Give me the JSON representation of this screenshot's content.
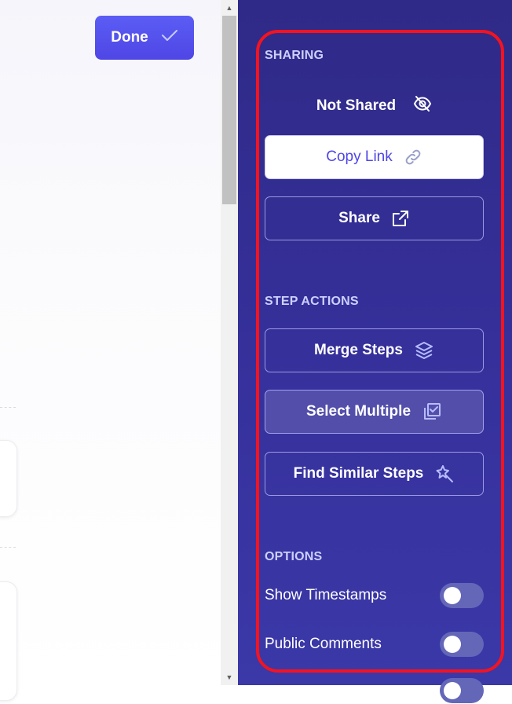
{
  "header": {
    "done_label": "Done"
  },
  "sharing": {
    "title": "SHARING",
    "status": "Not Shared",
    "copy_link_label": "Copy Link",
    "share_label": "Share"
  },
  "step_actions": {
    "title": "STEP ACTIONS",
    "merge_label": "Merge Steps",
    "select_multiple_label": "Select Multiple",
    "find_similar_label": "Find Similar Steps"
  },
  "options": {
    "title": "OPTIONS",
    "items": [
      {
        "label": "Show Timestamps",
        "enabled": false
      },
      {
        "label": "Public Comments",
        "enabled": false
      },
      {
        "label": "",
        "enabled": false
      }
    ]
  },
  "icons": {
    "done": "check-icon",
    "status": "eye-off-icon",
    "copy": "link-icon",
    "share": "external-link-icon",
    "merge": "layers-icon",
    "select": "multi-select-icon",
    "find": "magic-wand-icon"
  },
  "colors": {
    "panel_bg": "#2f2a87",
    "accent": "#4f46e5",
    "highlight_outline": "#f5131f"
  }
}
